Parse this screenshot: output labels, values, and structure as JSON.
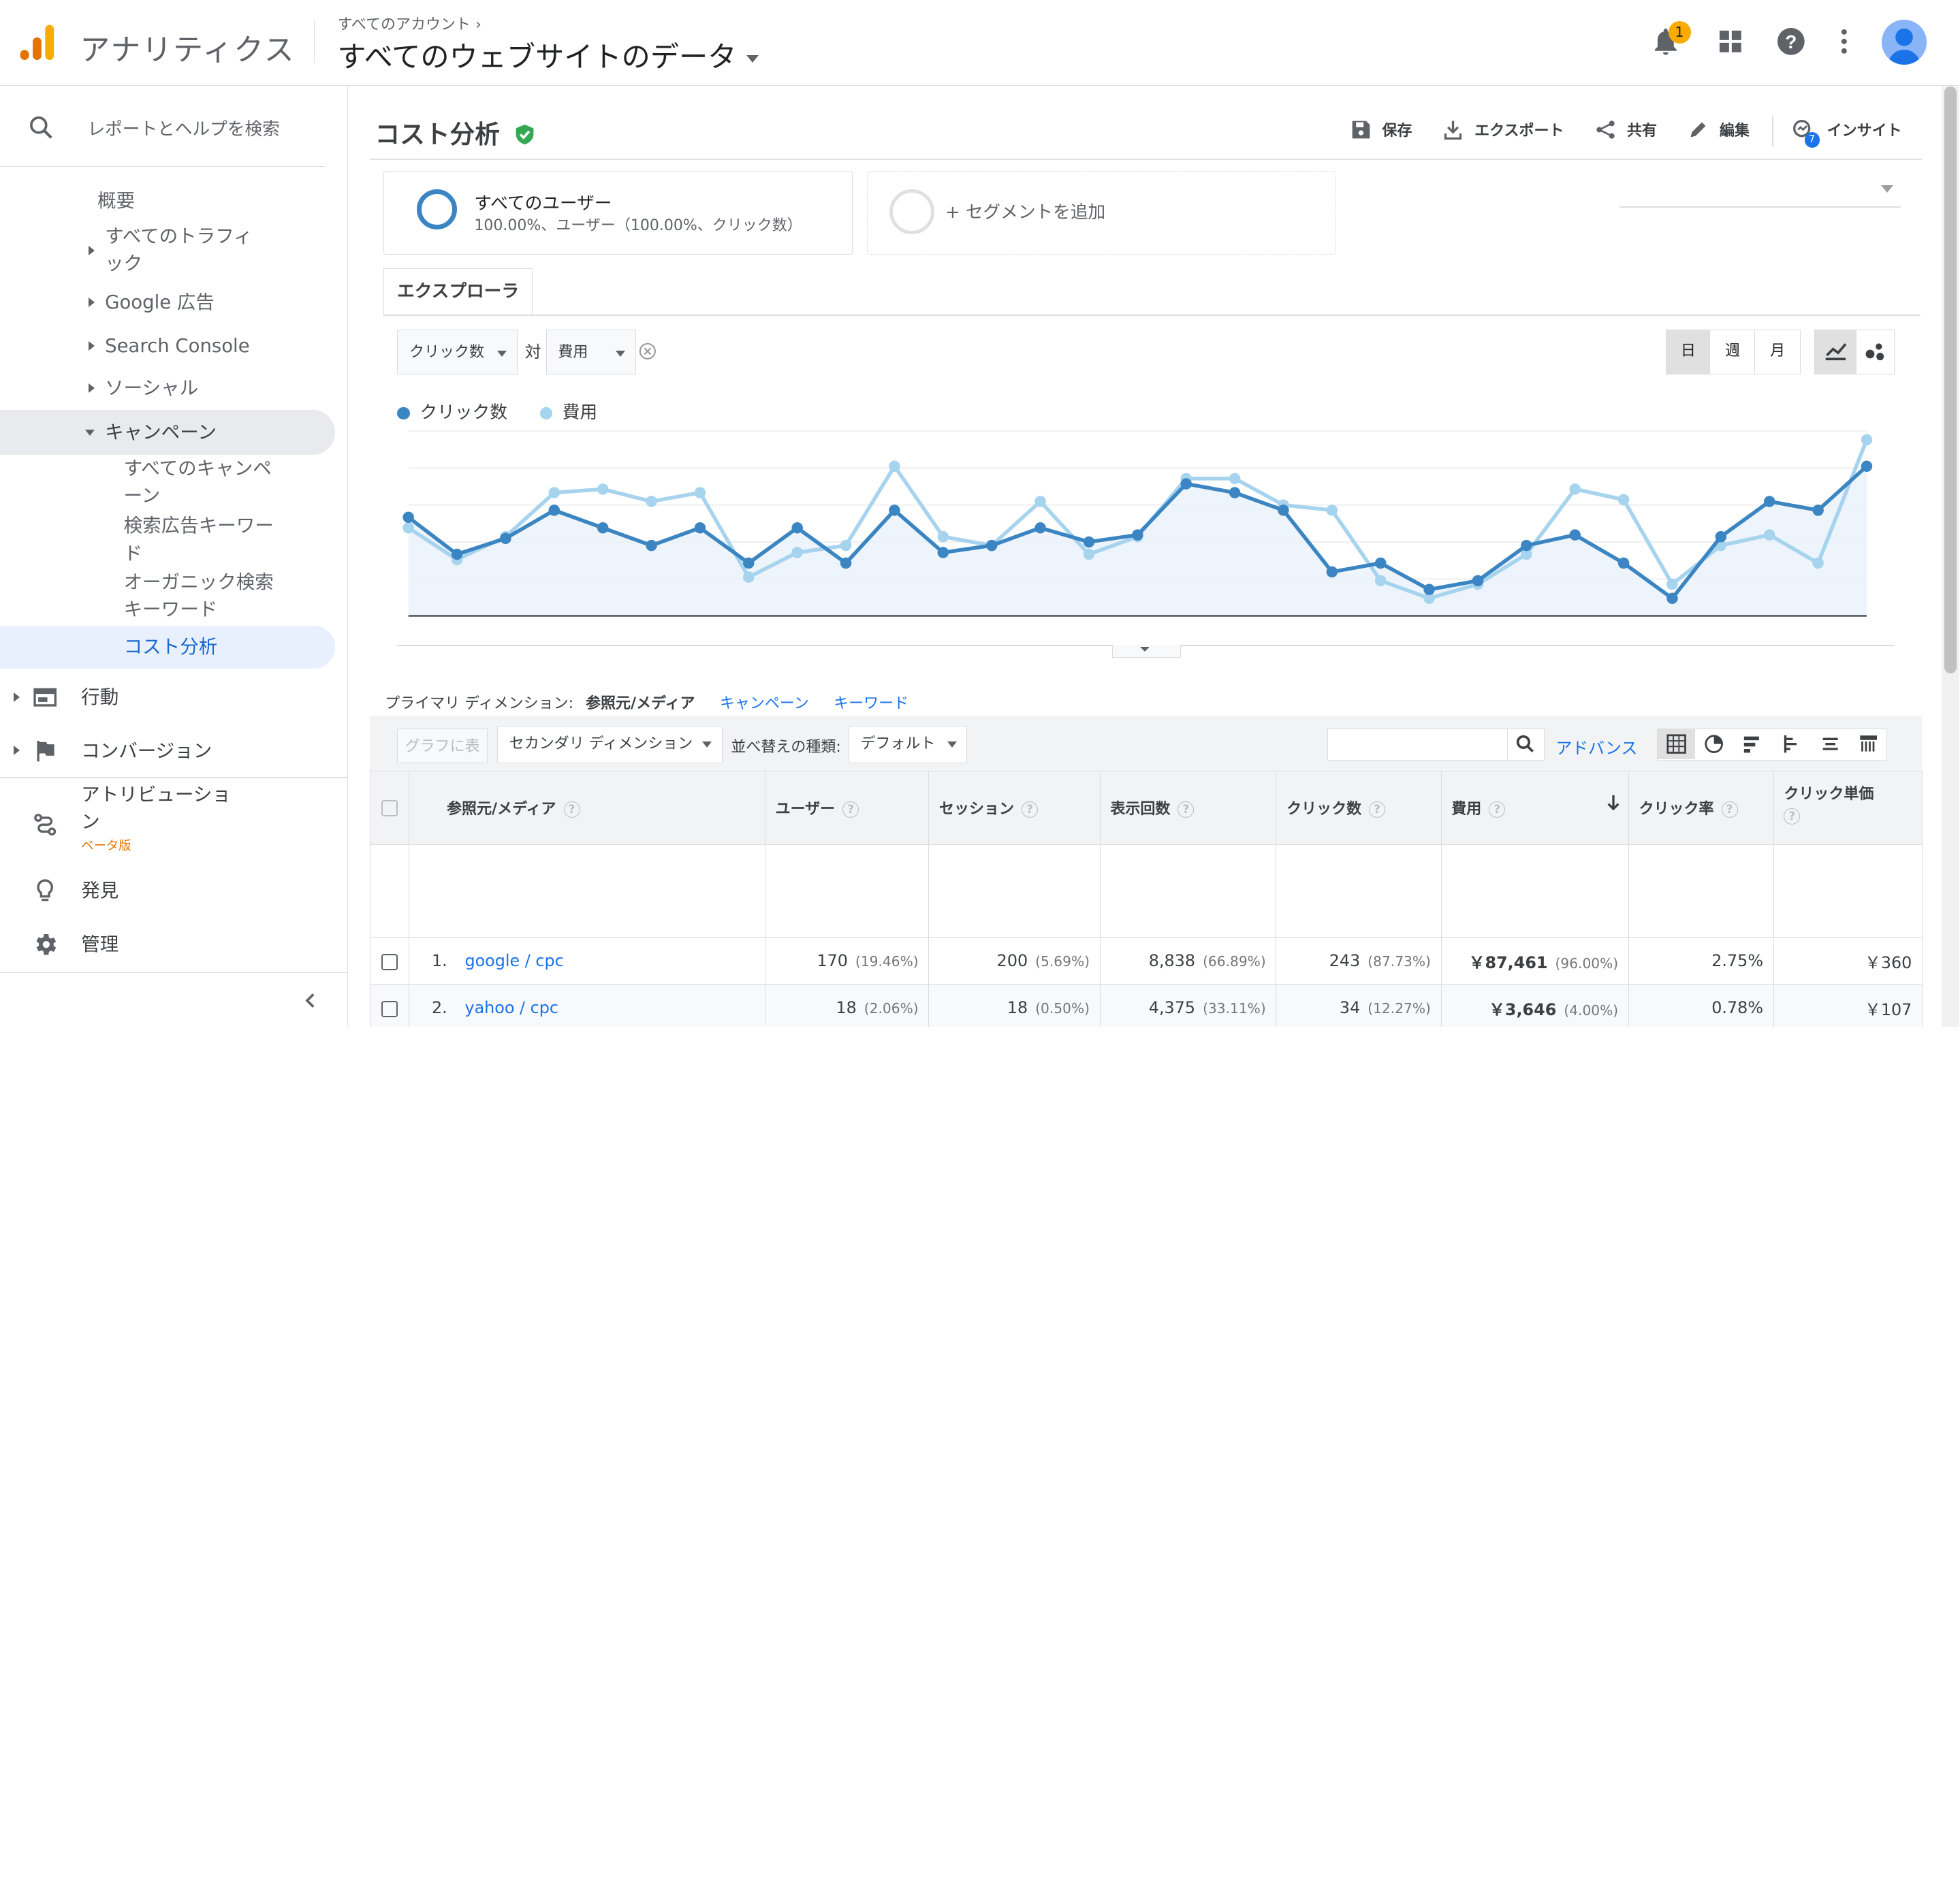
{
  "header": {
    "product": "アナリティクス",
    "breadcrumb": "すべてのアカウント",
    "property": "すべてのウェブサイトのデータ",
    "notification_count": "1"
  },
  "sidebar": {
    "search_placeholder": "レポートとヘルプを検索",
    "items": [
      {
        "label": "概要"
      },
      {
        "label1": "すべてのトラフィ",
        "label2": "ック"
      },
      {
        "label": "Google 広告"
      },
      {
        "label": "Search Console"
      },
      {
        "label": "ソーシャル"
      },
      {
        "label": "キャンペーン"
      },
      {
        "label1": "すべてのキャンペ",
        "label2": "ーン"
      },
      {
        "label1": "検索広告キーワー",
        "label2": "ド"
      },
      {
        "label1": "オーガニック検索",
        "label2": "キーワード"
      },
      {
        "label": "コスト分析"
      },
      {
        "label": "行動"
      },
      {
        "label": "コンバージョン"
      },
      {
        "label1": "アトリビューショ",
        "label2": "ン",
        "beta": "ベータ版"
      },
      {
        "label": "発見"
      },
      {
        "label": "管理"
      }
    ]
  },
  "report": {
    "title": "コスト分析",
    "actions": [
      "保存",
      "エクスポート",
      "共有",
      "編集",
      "インサイト"
    ],
    "insight_count": "7"
  },
  "segments": {
    "segment1_name": "すべてのユーザー",
    "segment1_detail": "100.00%、ユーザー（100.00%、クリック数）",
    "add_segment": "+ セグメントを追加"
  },
  "explorer": {
    "tab": "エクスプローラ",
    "metric1": "クリック数",
    "vs": "対",
    "metric2": "費用",
    "periods": [
      "日",
      "週",
      "月"
    ],
    "legend1": "クリック数",
    "legend2": "費用"
  },
  "chart_data": {
    "type": "line",
    "series": [
      {
        "name": "クリック数",
        "color": "#3b86c2",
        "values": [
          5.6,
          3.5,
          4.4,
          6.0,
          5.0,
          4.0,
          5.0,
          3.0,
          5.0,
          3.0,
          6.0,
          3.6,
          4.0,
          5.0,
          4.2,
          4.6,
          7.5,
          7.0,
          6.0,
          2.5,
          3.0,
          1.5,
          2.0,
          4.0,
          4.6,
          3.0,
          1.0,
          4.5,
          6.5,
          6.0,
          8.5
        ]
      },
      {
        "name": "費用",
        "color": "#a6d3ee",
        "values": [
          5.0,
          3.2,
          4.5,
          7.0,
          7.2,
          6.5,
          7.0,
          2.2,
          3.6,
          4.0,
          8.5,
          4.5,
          4.0,
          6.5,
          3.5,
          4.5,
          7.8,
          7.8,
          6.3,
          6.0,
          2.0,
          1.0,
          1.8,
          3.5,
          7.2,
          6.6,
          1.8,
          4.0,
          4.6,
          3.0,
          10.0
        ]
      }
    ],
    "ylim": [
      0,
      10.5
    ],
    "grid": true
  },
  "dimension": {
    "label": "プライマリ ディメンション:",
    "active": "参照元/メディア",
    "links": [
      "キャンペーン",
      "キーワード"
    ]
  },
  "toolbar": {
    "graph_btn": "グラフに表示",
    "secondary": "セカンダリ ディメンション",
    "sort_label": "並べ替えの種類:",
    "sort_value": "デフォルト",
    "advanced": "アドバンス"
  },
  "table": {
    "headers": [
      "参照元/メディア",
      "ユーザー",
      "セッション",
      "表示回数",
      "クリック数",
      "費用",
      "クリック率",
      "クリック単価"
    ],
    "rows": [
      {
        "idx": "1.",
        "name": "google / cpc",
        "users": "170",
        "users_pct": "(19.46%)",
        "sessions": "200",
        "sessions_pct": "(5.69%)",
        "impressions": "8,838",
        "impressions_pct": "(66.89%)",
        "clicks": "243",
        "clicks_pct": "(87.73%)",
        "cost": "￥87,461",
        "cost_pct": "(96.00%)",
        "ctr": "2.75%",
        "cpc": "￥360"
      },
      {
        "idx": "2.",
        "name": "yahoo / cpc",
        "users": "18",
        "users_pct": "(2.06%)",
        "sessions": "18",
        "sessions_pct": "(0.50%)",
        "impressions": "4,375",
        "impressions_pct": "(33.11%)",
        "clicks": "34",
        "clicks_pct": "(12.27%)",
        "cost": "￥3,646",
        "cost_pct": "(4.00%)",
        "ctr": "0.78%",
        "cpc": "￥107"
      }
    ]
  }
}
